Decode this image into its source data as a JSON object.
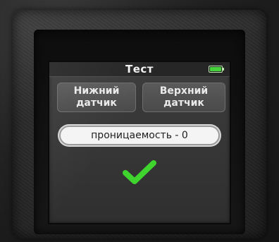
{
  "screen": {
    "title": "Тест",
    "battery": {
      "icon": "battery-icon",
      "level": 1.0,
      "color": "#46d23a"
    },
    "buttons": {
      "lower_sensor": {
        "line1": "Нижний",
        "line2": "датчик"
      },
      "upper_sensor": {
        "line1": "Верхний",
        "line2": "датчик"
      }
    },
    "result_field": {
      "value": "проницаемость - 0"
    },
    "status_icon": {
      "icon": "checkmark-icon",
      "color": "#3fd42e"
    }
  }
}
